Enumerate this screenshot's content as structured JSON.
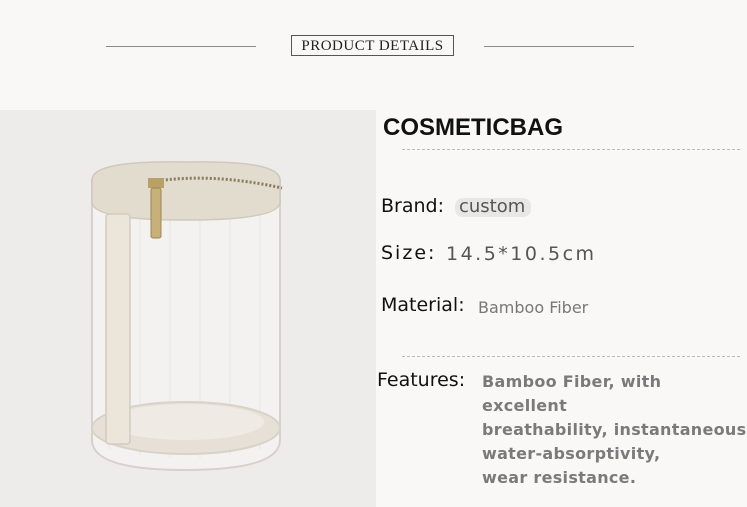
{
  "header": {
    "title": "PRODUCT DETAILS"
  },
  "product": {
    "title": "COSMETICBAG",
    "image_alt": "Cylindrical mesh cosmetic bag with gold zipper and canvas handle",
    "brand_label": "Brand:",
    "brand_value": "custom",
    "size_label": "Size:",
    "size_value": "14.5*10.5cm",
    "material_label": "Material:",
    "material_value": "Bamboo Fiber",
    "features_label": "Features:",
    "features_lines": [
      "Bamboo Fiber, with excellent",
      "breathability, instantaneous",
      "water-absorptivity,",
      "wear resistance."
    ]
  }
}
